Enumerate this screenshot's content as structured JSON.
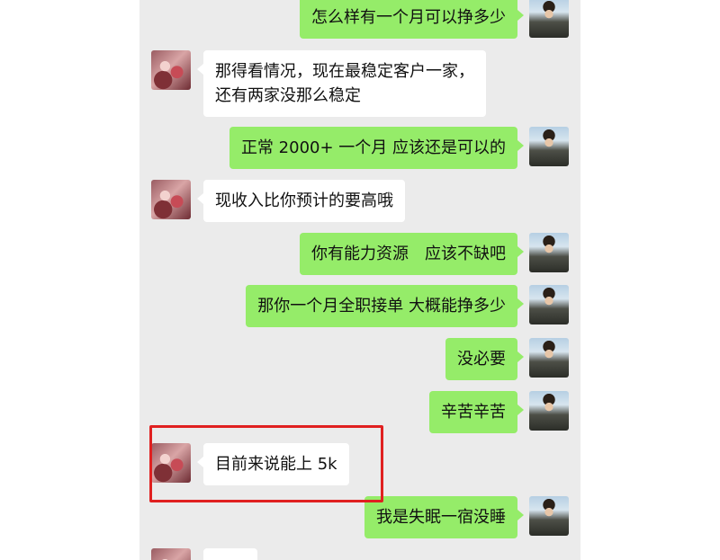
{
  "messages": [
    {
      "side": "right",
      "text": "怎么样有一个月可以挣多少"
    },
    {
      "side": "left",
      "lines": [
        "那得看情况，现在最稳定客户一家，",
        "还有两家没那么稳定"
      ]
    },
    {
      "side": "right",
      "text": "正常 2000+ 一个月 应该还是可以的"
    },
    {
      "side": "left",
      "text": "现收入比你预计的要高哦"
    },
    {
      "side": "right",
      "text": "你有能力资源　应该不缺吧"
    },
    {
      "side": "right",
      "text": "那你一个月全职接单 大概能挣多少"
    },
    {
      "side": "right",
      "text": "没必要"
    },
    {
      "side": "right",
      "text": "辛苦辛苦"
    },
    {
      "side": "left",
      "text": "目前来说能上 5k",
      "highlighted": true
    },
    {
      "side": "right",
      "text": "我是失眠一宿没睡"
    }
  ],
  "colors": {
    "chat_bg": "#ebebeb",
    "sent_bubble": "#95ec69",
    "received_bubble": "#ffffff",
    "highlight_border": "#e02020"
  }
}
